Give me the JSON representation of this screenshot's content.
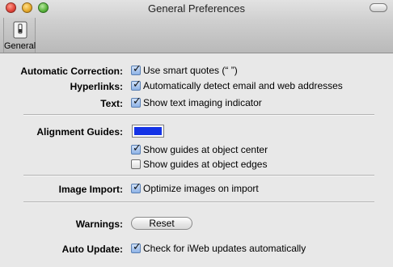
{
  "window": {
    "title": "General Preferences"
  },
  "toolbar": {
    "tabs": [
      {
        "label": "General",
        "icon": "switch-icon"
      }
    ]
  },
  "prefs": {
    "automatic_correction": {
      "label": "Automatic Correction:",
      "option": "Use smart quotes (“ ”)",
      "checked": true
    },
    "hyperlinks": {
      "label": "Hyperlinks:",
      "option": "Automatically detect email and web addresses",
      "checked": true
    },
    "text": {
      "label": "Text:",
      "option": "Show text imaging indicator",
      "checked": true
    },
    "alignment_guides": {
      "label": "Alignment Guides:",
      "color": "#1433e6",
      "options": [
        {
          "label": "Show guides at object center",
          "checked": true
        },
        {
          "label": "Show guides at object edges",
          "checked": false
        }
      ]
    },
    "image_import": {
      "label": "Image Import:",
      "option": "Optimize images on import",
      "checked": true
    },
    "warnings": {
      "label": "Warnings:",
      "button": "Reset"
    },
    "auto_update": {
      "label": "Auto Update:",
      "option": "Check for iWeb updates automatically",
      "checked": true
    }
  }
}
